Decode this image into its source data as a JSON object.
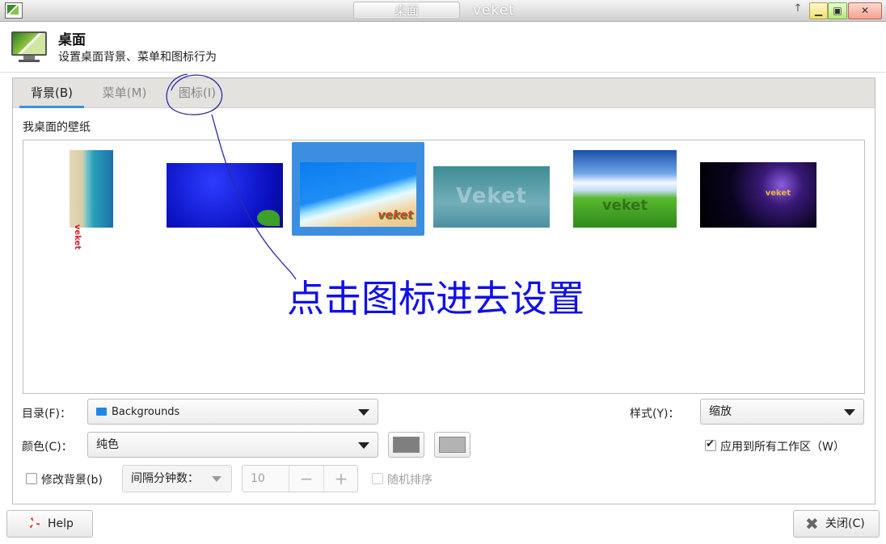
{
  "titlebar": {
    "tab_label": "桌面",
    "app_name": "veket",
    "pin_glyph": "↑",
    "min_glyph": "▁",
    "max_glyph": "▣",
    "close_glyph": "✕"
  },
  "header": {
    "title": "桌面",
    "subtitle": "设置桌面背景、菜单和图标行为"
  },
  "tabs": [
    {
      "label": "背景(B)",
      "active": true
    },
    {
      "label": "菜单(M)",
      "active": false
    },
    {
      "label": "图标(I)",
      "active": false
    }
  ],
  "wallpaper": {
    "section_label": "我桌面的壁纸",
    "selected_index": 2,
    "thumb_logos": [
      "veket",
      "",
      "veket",
      "Veket",
      "veket",
      "veket"
    ]
  },
  "annotation": {
    "text": "点击图标进去设置",
    "color": "#1010e8"
  },
  "controls": {
    "dir_label": "目录(F)：",
    "dir_value": "Backgrounds",
    "style_label": "样式(Y)：",
    "style_value": "缩放",
    "color_label": "颜色(C)：",
    "color_value": "纯色",
    "primary_color": "#7f7f7f",
    "secondary_color": "#b3b3b3",
    "apply_all_label": "应用到所有工作区（W）",
    "apply_all_checked": true,
    "change_bg_label": "修改背景(b)",
    "change_bg_checked": false,
    "interval_label": "间隔分钟数：",
    "interval_value": "10",
    "spin_minus": "−",
    "spin_plus": "+",
    "random_label": "随机排序",
    "random_checked": false
  },
  "footer": {
    "help_label": "Help",
    "close_label": "关闭(C)"
  },
  "colors": {
    "accent": "#3c8fe0",
    "annotation": "#1010e8"
  }
}
